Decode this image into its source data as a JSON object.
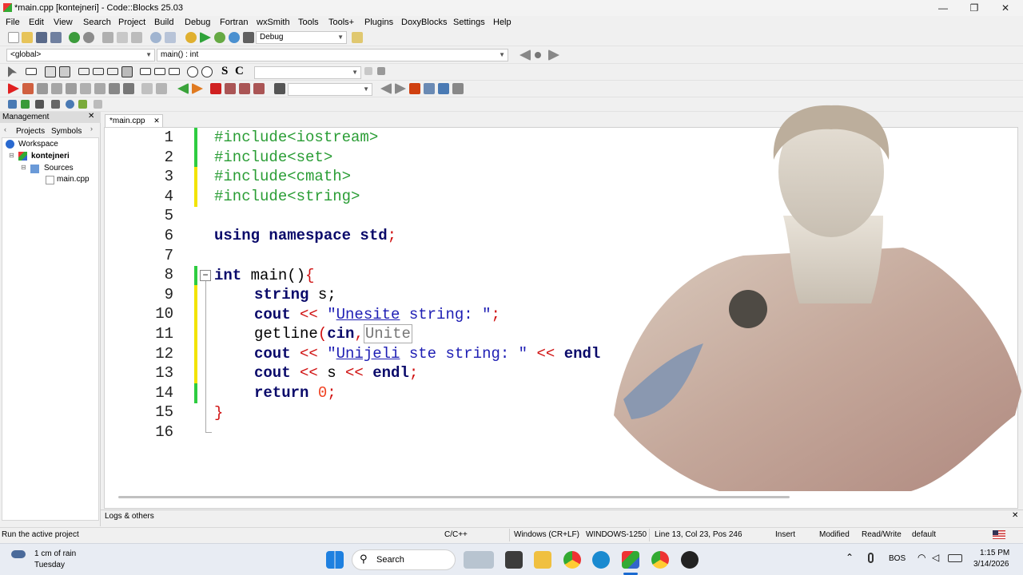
{
  "window": {
    "title": "*main.cpp [kontejneri] - Code::Blocks 25.03",
    "minimize": "—",
    "maximize": "❐",
    "close": "✕"
  },
  "menu": [
    "File",
    "Edit",
    "View",
    "Search",
    "Project",
    "Build",
    "Debug",
    "Fortran",
    "wxSmith",
    "Tools",
    "Tools+",
    "Plugins",
    "DoxyBlocks",
    "Settings",
    "Help"
  ],
  "toolbar": {
    "build_target": "Debug",
    "scope": "<global>",
    "function": "main() : int",
    "toolbar_S": "S",
    "toolbar_C": "C"
  },
  "management": {
    "title": "Management",
    "close": "✕",
    "tabs": [
      "Projects",
      "Symbols"
    ],
    "tree": {
      "workspace": "Workspace",
      "project": "kontejneri",
      "sources": "Sources",
      "file": "main.cpp"
    }
  },
  "editor": {
    "tab_label": "*main.cpp",
    "tab_close": "✕",
    "line_numbers": [
      "1",
      "2",
      "3",
      "4",
      "5",
      "6",
      "7",
      "8",
      "9",
      "10",
      "11",
      "12",
      "13",
      "14",
      "15",
      "16"
    ],
    "code": {
      "l1": "#include<iostream>",
      "l2": "#include<set>",
      "l3": "#include<cmath>",
      "l4": "#include<string>",
      "l6_kw": "using namespace std",
      "l6_end": ";",
      "l8_kw": "int",
      "l8_rest": " main()",
      "l8_brace": "{",
      "l9_kw": "string",
      "l9_rest": " s;",
      "l10_kw": "cout",
      "l10_op": " << ",
      "l10_str_q1": "\"",
      "l10_str_ul": "Unesite",
      "l10_str_rest": " string: \"",
      "l10_end": ";",
      "l11_fn": "getline",
      "l11_paren": "(",
      "l11_kw": "cin",
      "l11_comma": ",",
      "l11_hint": "Unite",
      "l12_kw": "cout",
      "l12_op": " << ",
      "l12_str_q1": "\"",
      "l12_str_ul": "Unijeli",
      "l12_str_rest": " ste string: \"",
      "l12_op2": " << ",
      "l12_kw2": "endl",
      "l13_kw": "cout",
      "l13_op": " << ",
      "l13_var": "s",
      "l13_op2": " << ",
      "l13_kw2": "endl",
      "l13_end": ";",
      "l14_kw": "return",
      "l14_num": " 0",
      "l14_end": ";",
      "l15": "}"
    }
  },
  "logs": {
    "title": "Logs & others",
    "close": "✕"
  },
  "status": {
    "message": "Run the active project",
    "language": "C/C++",
    "line_endings": "Windows (CR+LF)",
    "encoding": "WINDOWS-1250",
    "position": "Line 13, Col 23, Pos 246",
    "mode": "Insert",
    "modified": "Modified",
    "access": "Read/Write",
    "profile": "default"
  },
  "taskbar": {
    "weather_temp": "1 cm of rain",
    "weather_day": "Tuesday",
    "search": "Search",
    "language": "BOS",
    "time": "1:15 PM",
    "date": "3/14/2026"
  },
  "colors": {
    "accent_green": "#2ecc40",
    "accent_yellow": "#f2e400",
    "preprocessor": "#2a9d35",
    "keyword": "#0a0a6a",
    "string": "#1e1eb4",
    "number": "#f04020"
  }
}
